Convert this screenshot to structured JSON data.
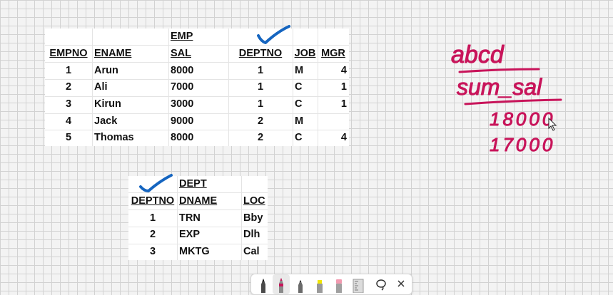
{
  "emp_table": {
    "title": "EMP",
    "headers": [
      "EMPNO",
      "ENAME",
      "SAL",
      "DEPTNO",
      "JOB",
      "MGR"
    ],
    "rows": [
      [
        "1",
        "Arun",
        "8000",
        "1",
        "M",
        "4"
      ],
      [
        "2",
        "Ali",
        "7000",
        "1",
        "C",
        "1"
      ],
      [
        "3",
        "Kirun",
        "3000",
        "1",
        "C",
        "1"
      ],
      [
        "4",
        "Jack",
        "9000",
        "2",
        "M",
        ""
      ],
      [
        "5",
        "Thomas",
        "8000",
        "2",
        "C",
        "4"
      ]
    ]
  },
  "dept_table": {
    "title": "DEPT",
    "headers": [
      "DEPTNO",
      "DNAME",
      "LOC"
    ],
    "rows": [
      [
        "1",
        "TRN",
        "Bby"
      ],
      [
        "2",
        "EXP",
        "Dlh"
      ],
      [
        "3",
        "MKTG",
        "Cal"
      ]
    ]
  },
  "annotations": {
    "handwriting_lines": [
      "abcd",
      "sum_sal",
      "18000",
      "17000"
    ],
    "ink_colors": {
      "magenta": "#c8145a",
      "blue": "#1565c0"
    }
  },
  "toolbar": {
    "tools": [
      "pen-icon",
      "marker-icon",
      "pencil-icon",
      "highlighter-icon",
      "eraser-icon",
      "ruler-icon",
      "lasso-icon",
      "close-icon"
    ],
    "selected": "marker-icon"
  }
}
